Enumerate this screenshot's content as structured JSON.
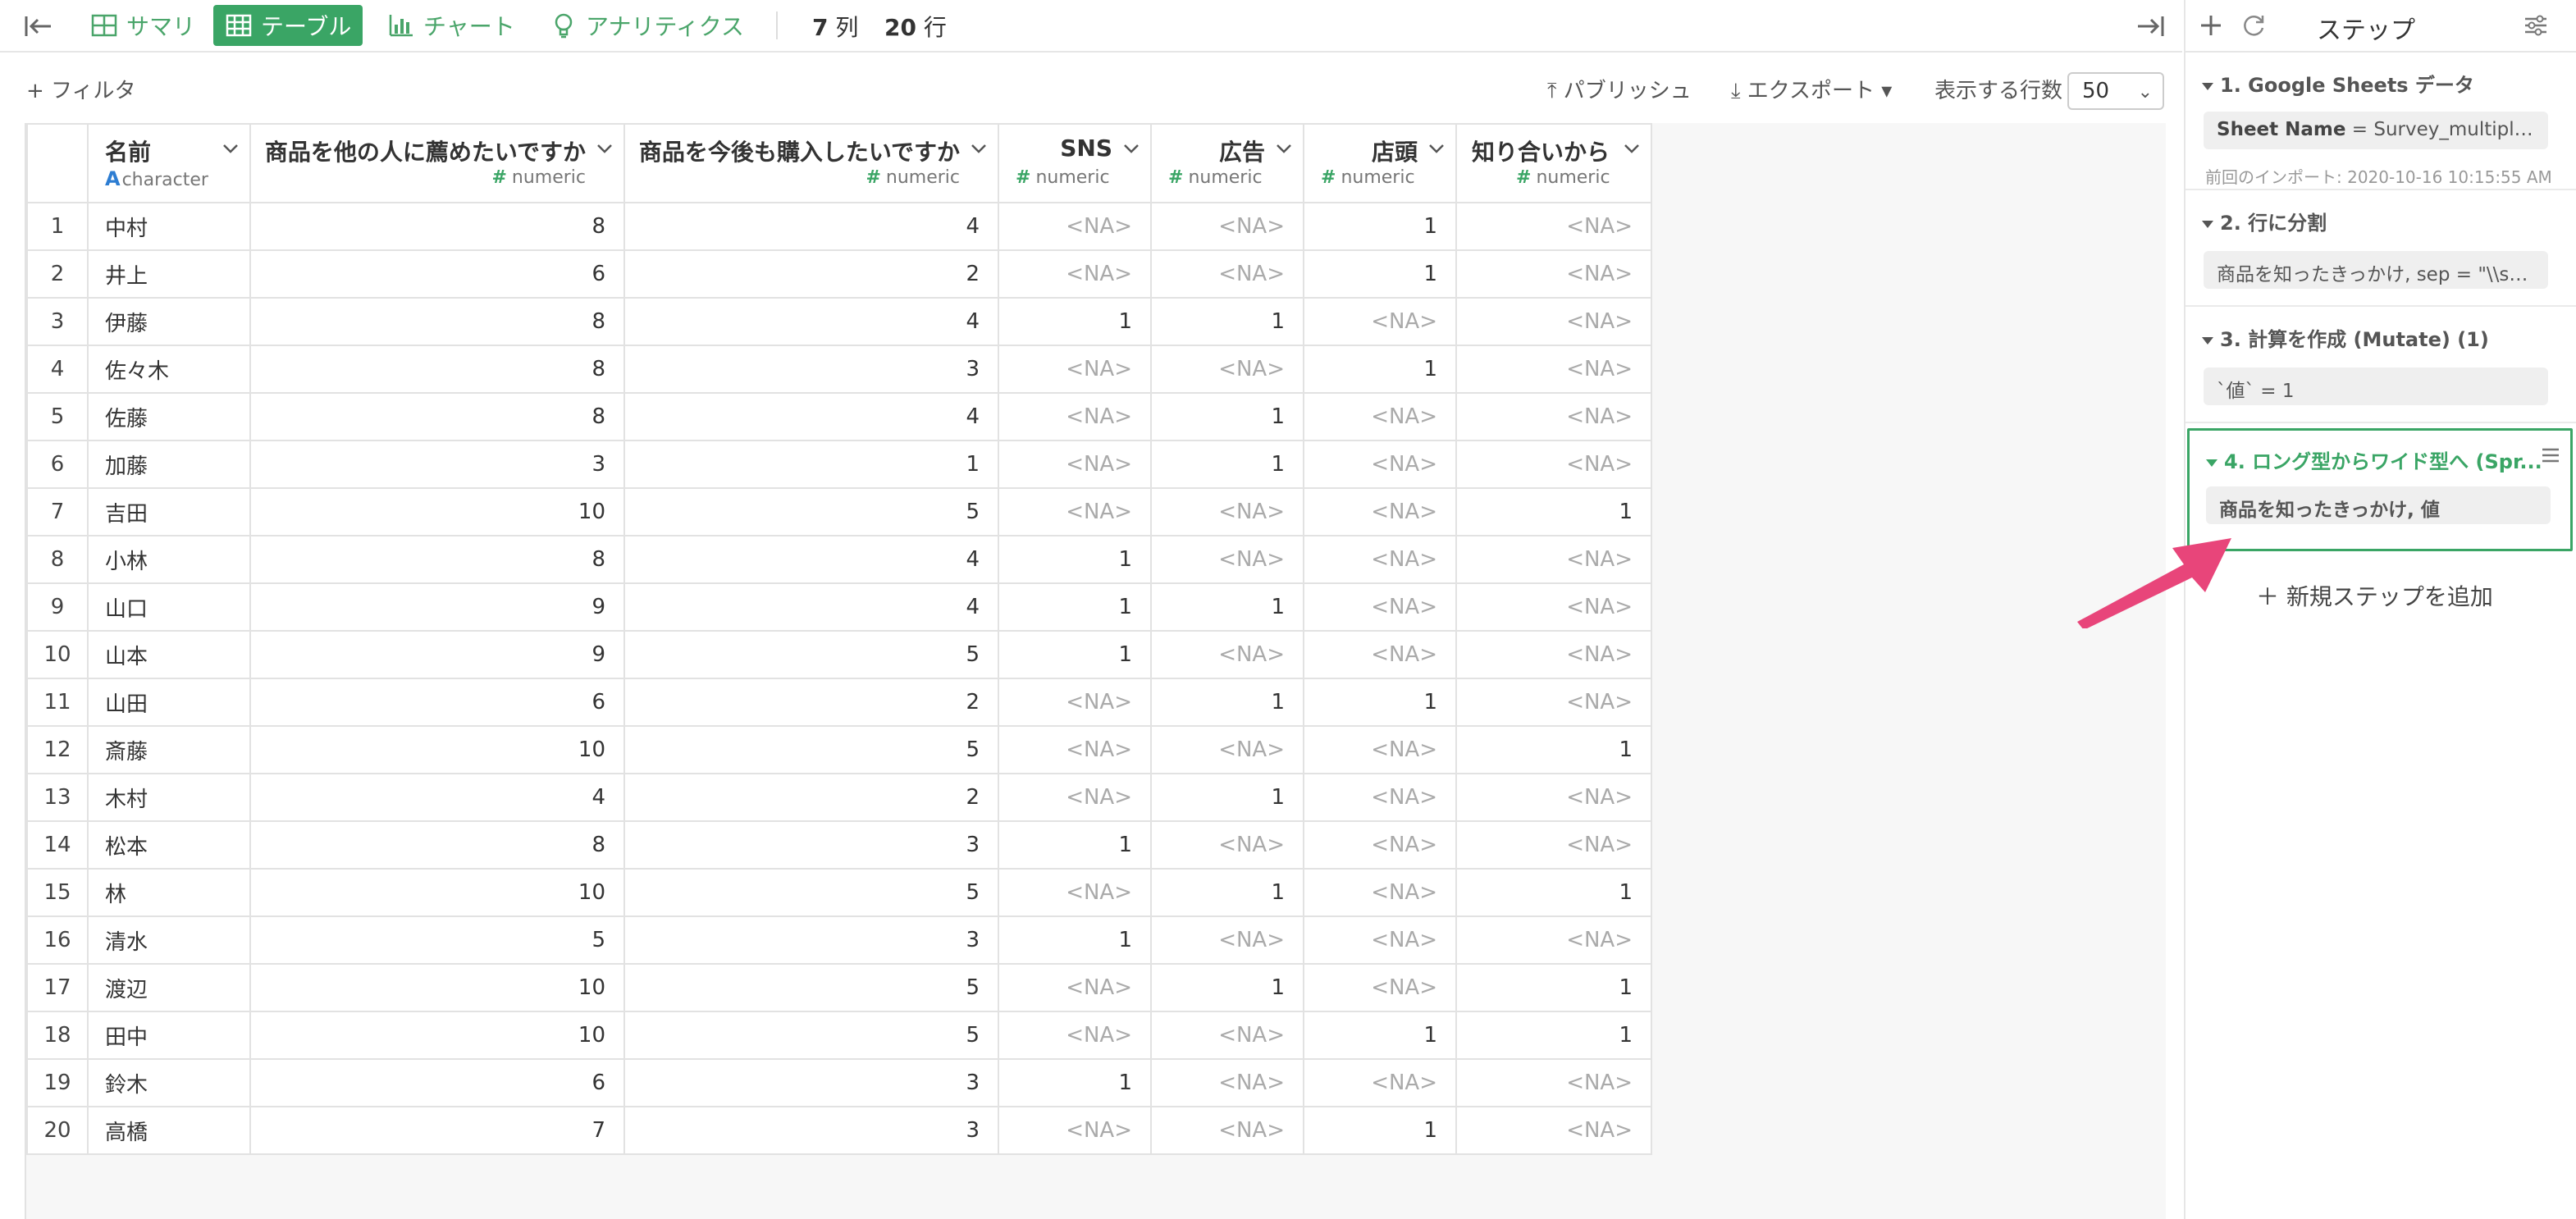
{
  "topbar": {
    "tabs": [
      {
        "label": "サマリ",
        "icon": "summary-grid-icon",
        "active": false
      },
      {
        "label": "テーブル",
        "icon": "table-icon",
        "active": true
      },
      {
        "label": "チャート",
        "icon": "bar-chart-icon",
        "active": false
      },
      {
        "label": "アナリティクス",
        "icon": "lightbulb-icon",
        "active": false
      }
    ],
    "columns_count": "7",
    "columns_unit": "列",
    "rows_count": "20",
    "rows_unit": "行"
  },
  "toolbar": {
    "filter": "+ フィルタ",
    "publish": "パブリッシュ",
    "export": "エクスポート",
    "rows_label": "表示する行数",
    "rows_value": "50"
  },
  "table": {
    "columns": [
      {
        "name": "名前",
        "type": "character"
      },
      {
        "name": "商品を他の人に薦めたいですか",
        "type": "numeric"
      },
      {
        "name": "商品を今後も購入したいですか",
        "type": "numeric"
      },
      {
        "name": "SNS",
        "type": "numeric"
      },
      {
        "name": "広告",
        "type": "numeric"
      },
      {
        "name": "店頭",
        "type": "numeric"
      },
      {
        "name": "知り合いから",
        "type": "numeric"
      }
    ],
    "rows": [
      [
        "1",
        "中村",
        "8",
        "4",
        "<NA>",
        "<NA>",
        "1",
        "<NA>"
      ],
      [
        "2",
        "井上",
        "6",
        "2",
        "<NA>",
        "<NA>",
        "1",
        "<NA>"
      ],
      [
        "3",
        "伊藤",
        "8",
        "4",
        "1",
        "1",
        "<NA>",
        "<NA>"
      ],
      [
        "4",
        "佐々木",
        "8",
        "3",
        "<NA>",
        "<NA>",
        "1",
        "<NA>"
      ],
      [
        "5",
        "佐藤",
        "8",
        "4",
        "<NA>",
        "1",
        "<NA>",
        "<NA>"
      ],
      [
        "6",
        "加藤",
        "3",
        "1",
        "<NA>",
        "1",
        "<NA>",
        "<NA>"
      ],
      [
        "7",
        "吉田",
        "10",
        "5",
        "<NA>",
        "<NA>",
        "<NA>",
        "1"
      ],
      [
        "8",
        "小林",
        "8",
        "4",
        "1",
        "<NA>",
        "<NA>",
        "<NA>"
      ],
      [
        "9",
        "山口",
        "9",
        "4",
        "1",
        "1",
        "<NA>",
        "<NA>"
      ],
      [
        "10",
        "山本",
        "9",
        "5",
        "1",
        "<NA>",
        "<NA>",
        "<NA>"
      ],
      [
        "11",
        "山田",
        "6",
        "2",
        "<NA>",
        "1",
        "1",
        "<NA>"
      ],
      [
        "12",
        "斎藤",
        "10",
        "5",
        "<NA>",
        "<NA>",
        "<NA>",
        "1"
      ],
      [
        "13",
        "木村",
        "4",
        "2",
        "<NA>",
        "1",
        "<NA>",
        "<NA>"
      ],
      [
        "14",
        "松本",
        "8",
        "3",
        "1",
        "<NA>",
        "<NA>",
        "<NA>"
      ],
      [
        "15",
        "林",
        "10",
        "5",
        "<NA>",
        "1",
        "<NA>",
        "1"
      ],
      [
        "16",
        "清水",
        "5",
        "3",
        "1",
        "<NA>",
        "<NA>",
        "<NA>"
      ],
      [
        "17",
        "渡辺",
        "10",
        "5",
        "<NA>",
        "1",
        "<NA>",
        "1"
      ],
      [
        "18",
        "田中",
        "10",
        "5",
        "<NA>",
        "<NA>",
        "1",
        "1"
      ],
      [
        "19",
        "鈴木",
        "6",
        "3",
        "1",
        "<NA>",
        "<NA>",
        "<NA>"
      ],
      [
        "20",
        "高橋",
        "7",
        "3",
        "<NA>",
        "<NA>",
        "1",
        "<NA>"
      ]
    ]
  },
  "steps_panel": {
    "title": "ステップ",
    "steps": [
      {
        "title": "1. Google Sheets データ",
        "box_key": "Sheet Name",
        "box_value": " = Survey_multiple, Wo...",
        "note": "前回のインポート: 2020-10-16 10:15:55 AM"
      },
      {
        "title": "2. 行に分割",
        "box_value": "商品を知ったきっかけ, sep = \"\\\\s*\\\\..."
      },
      {
        "title": "3. 計算を作成 (Mutate) (1)",
        "box_value": "`値` = 1"
      },
      {
        "title": "4. ロング型からワイド型へ (Spr...",
        "box_value": "商品を知ったきっかけ, 値"
      }
    ],
    "add_step": "新規ステップを追加"
  },
  "colors": {
    "accent": "#3aa565",
    "arrow": "#e8457a"
  }
}
